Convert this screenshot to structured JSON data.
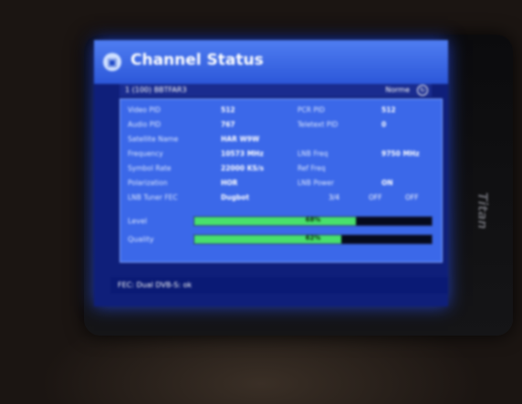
{
  "window": {
    "title": "Channel Status",
    "icon": "tv-icon"
  },
  "infobar": {
    "channel": "1 (100) BBTFAR3",
    "region": "Norme"
  },
  "rows": [
    {
      "label": "Video PID",
      "value": "512",
      "label2": "PCR PID",
      "value2": "512"
    },
    {
      "label": "Audio PID",
      "value": "767",
      "label2": "Teletext PID",
      "value2": "0"
    },
    {
      "label": "Satellite Name",
      "value": "HAR W9W"
    },
    {
      "label": "Frequency",
      "value": "10573 MHz",
      "label2": "LNB Freq",
      "value2": "9750 MHz"
    },
    {
      "label": "Symbol Rate",
      "value": "22000 KS/s",
      "label2": "Ref Freq"
    },
    {
      "label": "Polarization",
      "value": "HOR",
      "label2": "LNB Power",
      "value2": "ON"
    }
  ],
  "fec_row": {
    "label": "LNB Tuner FEC",
    "mode": "Dugbot",
    "fec": "3/4",
    "extra1": "OFF",
    "extra2": "OFF"
  },
  "meters": {
    "level": {
      "label": "Level",
      "percent": 68,
      "text": "68%"
    },
    "quality": {
      "label": "Quality",
      "percent": 62,
      "text": "62%"
    }
  },
  "footer": {
    "text": "FEC: Dual DVB-S: ok"
  },
  "colors": {
    "header": "#2c57d9",
    "panel": "#3b68e9",
    "meter_fill": "#48e06c",
    "screen_bg": "#0f1f7a"
  },
  "brand": "Titan"
}
